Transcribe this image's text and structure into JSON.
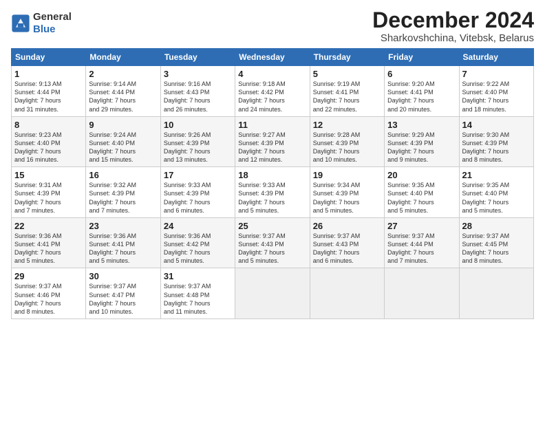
{
  "logo": {
    "general": "General",
    "blue": "Blue"
  },
  "title": "December 2024",
  "subtitle": "Sharkovshchina, Vitebsk, Belarus",
  "days_of_week": [
    "Sunday",
    "Monday",
    "Tuesday",
    "Wednesday",
    "Thursday",
    "Friday",
    "Saturday"
  ],
  "weeks": [
    [
      {
        "day": "1",
        "sunrise": "9:13 AM",
        "sunset": "4:44 PM",
        "daylight": "7 hours and 31 minutes."
      },
      {
        "day": "2",
        "sunrise": "9:14 AM",
        "sunset": "4:44 PM",
        "daylight": "7 hours and 29 minutes."
      },
      {
        "day": "3",
        "sunrise": "9:16 AM",
        "sunset": "4:43 PM",
        "daylight": "7 hours and 26 minutes."
      },
      {
        "day": "4",
        "sunrise": "9:18 AM",
        "sunset": "4:42 PM",
        "daylight": "7 hours and 24 minutes."
      },
      {
        "day": "5",
        "sunrise": "9:19 AM",
        "sunset": "4:41 PM",
        "daylight": "7 hours and 22 minutes."
      },
      {
        "day": "6",
        "sunrise": "9:20 AM",
        "sunset": "4:41 PM",
        "daylight": "7 hours and 20 minutes."
      },
      {
        "day": "7",
        "sunrise": "9:22 AM",
        "sunset": "4:40 PM",
        "daylight": "7 hours and 18 minutes."
      }
    ],
    [
      {
        "day": "8",
        "sunrise": "9:23 AM",
        "sunset": "4:40 PM",
        "daylight": "7 hours and 16 minutes."
      },
      {
        "day": "9",
        "sunrise": "9:24 AM",
        "sunset": "4:40 PM",
        "daylight": "7 hours and 15 minutes."
      },
      {
        "day": "10",
        "sunrise": "9:26 AM",
        "sunset": "4:39 PM",
        "daylight": "7 hours and 13 minutes."
      },
      {
        "day": "11",
        "sunrise": "9:27 AM",
        "sunset": "4:39 PM",
        "daylight": "7 hours and 12 minutes."
      },
      {
        "day": "12",
        "sunrise": "9:28 AM",
        "sunset": "4:39 PM",
        "daylight": "7 hours and 10 minutes."
      },
      {
        "day": "13",
        "sunrise": "9:29 AM",
        "sunset": "4:39 PM",
        "daylight": "7 hours and 9 minutes."
      },
      {
        "day": "14",
        "sunrise": "9:30 AM",
        "sunset": "4:39 PM",
        "daylight": "7 hours and 8 minutes."
      }
    ],
    [
      {
        "day": "15",
        "sunrise": "9:31 AM",
        "sunset": "4:39 PM",
        "daylight": "7 hours and 7 minutes."
      },
      {
        "day": "16",
        "sunrise": "9:32 AM",
        "sunset": "4:39 PM",
        "daylight": "7 hours and 7 minutes."
      },
      {
        "day": "17",
        "sunrise": "9:33 AM",
        "sunset": "4:39 PM",
        "daylight": "7 hours and 6 minutes."
      },
      {
        "day": "18",
        "sunrise": "9:33 AM",
        "sunset": "4:39 PM",
        "daylight": "7 hours and 5 minutes."
      },
      {
        "day": "19",
        "sunrise": "9:34 AM",
        "sunset": "4:39 PM",
        "daylight": "7 hours and 5 minutes."
      },
      {
        "day": "20",
        "sunrise": "9:35 AM",
        "sunset": "4:40 PM",
        "daylight": "7 hours and 5 minutes."
      },
      {
        "day": "21",
        "sunrise": "9:35 AM",
        "sunset": "4:40 PM",
        "daylight": "7 hours and 5 minutes."
      }
    ],
    [
      {
        "day": "22",
        "sunrise": "9:36 AM",
        "sunset": "4:41 PM",
        "daylight": "7 hours and 5 minutes."
      },
      {
        "day": "23",
        "sunrise": "9:36 AM",
        "sunset": "4:41 PM",
        "daylight": "7 hours and 5 minutes."
      },
      {
        "day": "24",
        "sunrise": "9:36 AM",
        "sunset": "4:42 PM",
        "daylight": "7 hours and 5 minutes."
      },
      {
        "day": "25",
        "sunrise": "9:37 AM",
        "sunset": "4:43 PM",
        "daylight": "7 hours and 5 minutes."
      },
      {
        "day": "26",
        "sunrise": "9:37 AM",
        "sunset": "4:43 PM",
        "daylight": "7 hours and 6 minutes."
      },
      {
        "day": "27",
        "sunrise": "9:37 AM",
        "sunset": "4:44 PM",
        "daylight": "7 hours and 7 minutes."
      },
      {
        "day": "28",
        "sunrise": "9:37 AM",
        "sunset": "4:45 PM",
        "daylight": "7 hours and 8 minutes."
      }
    ],
    [
      {
        "day": "29",
        "sunrise": "9:37 AM",
        "sunset": "4:46 PM",
        "daylight": "7 hours and 8 minutes."
      },
      {
        "day": "30",
        "sunrise": "9:37 AM",
        "sunset": "4:47 PM",
        "daylight": "7 hours and 10 minutes."
      },
      {
        "day": "31",
        "sunrise": "9:37 AM",
        "sunset": "4:48 PM",
        "daylight": "7 hours and 11 minutes."
      },
      null,
      null,
      null,
      null
    ]
  ]
}
